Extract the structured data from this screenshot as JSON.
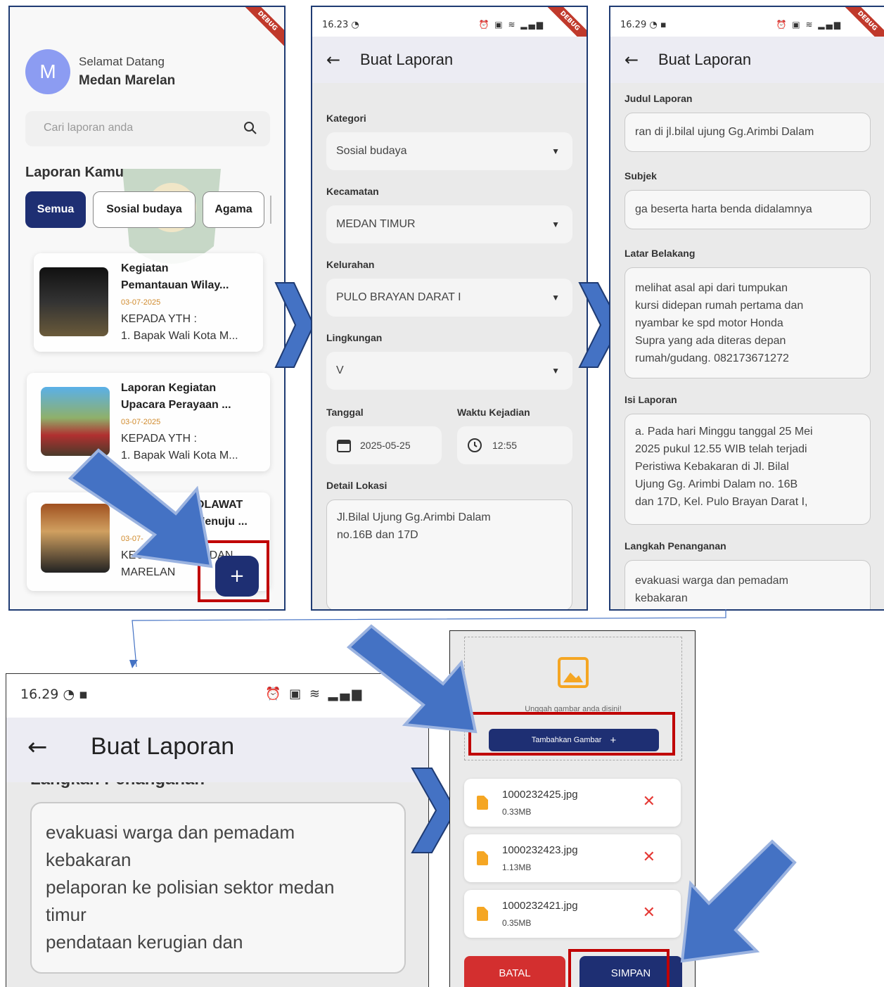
{
  "colors": {
    "navy": "#1e2f73",
    "accent_blue": "#4472c4",
    "red_highlight": "#c00000",
    "cancel_red": "#d32f2f",
    "file_orange": "#f5a623",
    "bg_form": "#eaeaea",
    "appbar": "#ececf3"
  },
  "panel1": {
    "status_time": "",
    "debug": "DEBUG",
    "avatar": "M",
    "welcome": "Selamat Datang",
    "username": "Medan Marelan",
    "search_placeholder": "Cari laporan anda",
    "section_title": "Laporan Kamu",
    "chips": [
      "Semua",
      "Sosial budaya",
      "Agama"
    ],
    "cards": [
      {
        "title": "Kegiatan\nPemantauan Wilay...",
        "date": "03-07-2025",
        "body": "KEPADA YTH :\n1. Bapak Wali Kota M..."
      },
      {
        "title": "Laporan Kegiatan\nUpacara Perayaan ...",
        "date": "03-07-2025",
        "body": "KEPADA YTH :\n1. Bapak Wali Kota M..."
      },
      {
        "title": "OLAWAT\nMenuju ...",
        "date": "03-07-",
        "body": "KECAMATAN MEDAN\nMARELAN"
      }
    ],
    "fab": "+"
  },
  "panel2": {
    "status_time": "16.23",
    "title": "Buat Laporan",
    "kategori_label": "Kategori",
    "kategori_value": "Sosial budaya",
    "kecamatan_label": "Kecamatan",
    "kecamatan_value": "MEDAN TIMUR",
    "kelurahan_label": "Kelurahan",
    "kelurahan_value": "PULO BRAYAN DARAT I",
    "lingkungan_label": "Lingkungan",
    "lingkungan_value": "V",
    "tanggal_label": "Tanggal",
    "tanggal_value": "2025-05-25",
    "waktu_label": "Waktu Kejadian",
    "waktu_value": "12:55",
    "detail_label": "Detail Lokasi",
    "detail_value": "Jl.Bilal Ujung Gg.Arimbi Dalam\nno.16B dan 17D"
  },
  "panel3": {
    "status_time": "16.29",
    "title": "Buat Laporan",
    "judul_label": "Judul Laporan",
    "judul_value": "ran di jl.bilal ujung Gg.Arimbi Dalam",
    "subjek_label": "Subjek",
    "subjek_value": "ga beserta harta benda didalamnya",
    "latar_label": "Latar Belakang",
    "latar_value": "melihat asal api dari tumpukan\nkursi didepan rumah pertama dan\nnyambar ke spd motor Honda\nSupra yang ada diteras depan\nrumah/gudang. 082173671272",
    "isi_label": "Isi Laporan",
    "isi_value": "a. Pada hari Minggu tanggal 25 Mei\n2025 pukul 12.55 WIB telah terjadi\nPeristiwa Kebakaran di Jl. Bilal\nUjung Gg. Arimbi Dalam no. 16B\ndan 17D, Kel. Pulo Brayan Darat I,",
    "langkah_label": "Langkah Penanganan",
    "langkah_value": "evakuasi warga dan pemadam\nkebakaran\npelaporan ke polisian sektor medan"
  },
  "panel4": {
    "status_time": "16.29",
    "title": "Buat Laporan",
    "langkah_label": "Langkah Penanganan",
    "langkah_value": "evakuasi warga dan pemadam\nkebakaran\npelaporan ke polisian sektor medan\ntimur\npendataan kerugian dan"
  },
  "panel5": {
    "upload_hint": "Unggah gambar anda disini!",
    "add_button": "Tambahkan Gambar",
    "files": [
      {
        "name": "1000232425.jpg",
        "size": "0.33MB"
      },
      {
        "name": "1000232423.jpg",
        "size": "1.13MB"
      },
      {
        "name": "1000232421.jpg",
        "size": "0.35MB"
      }
    ],
    "cancel": "BATAL",
    "save": "SIMPAN"
  }
}
